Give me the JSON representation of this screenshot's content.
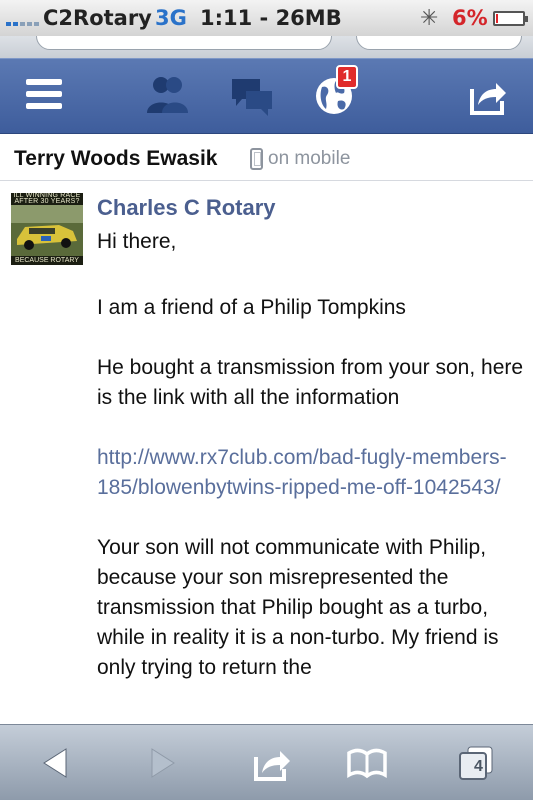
{
  "status": {
    "carrier": "C2Rotary",
    "network": "3G",
    "time_data": "1:11 - 26MB",
    "battery_percent": "6%",
    "battery_level": 0.06,
    "activity_icon": "spinner-icon"
  },
  "fb_nav": {
    "icons": [
      "menu-icon",
      "friend-requests-icon",
      "messages-icon",
      "notifications-globe-icon",
      "share-icon"
    ],
    "notification_count": "1"
  },
  "conversation": {
    "name": "Terry Woods Ewasik",
    "device_status": "on mobile"
  },
  "message": {
    "avatar_caption_top": "ILL WINNING RACE AFTER 30 YEARS?",
    "avatar_caption_bottom": "BECAUSE ROTARY",
    "sender": "Charles C Rotary",
    "paragraphs": [
      "Hi there,",
      "I am a friend of a Philip Tompkins",
      "He bought a transmission from your son, here is the link with all the information",
      "http://www.rx7club.com/bad-fugly-members-185/blowenbytwins-ripped-me-off-1042543/",
      "Your son will not communicate with Philip, because your son misrepresented the transmission that Philip bought as a turbo, while in reality it is a non-turbo. My friend is only trying to return the"
    ]
  },
  "safari_toolbar": {
    "icons": [
      "back-icon",
      "forward-icon",
      "action-icon",
      "bookmarks-icon",
      "tabs-icon"
    ],
    "tab_count": "4"
  },
  "colors": {
    "fb_blue": "#3e5d9c",
    "link": "#5a6f9c",
    "sender": "#4b5f8f",
    "badge_red": "#e02c2c"
  }
}
